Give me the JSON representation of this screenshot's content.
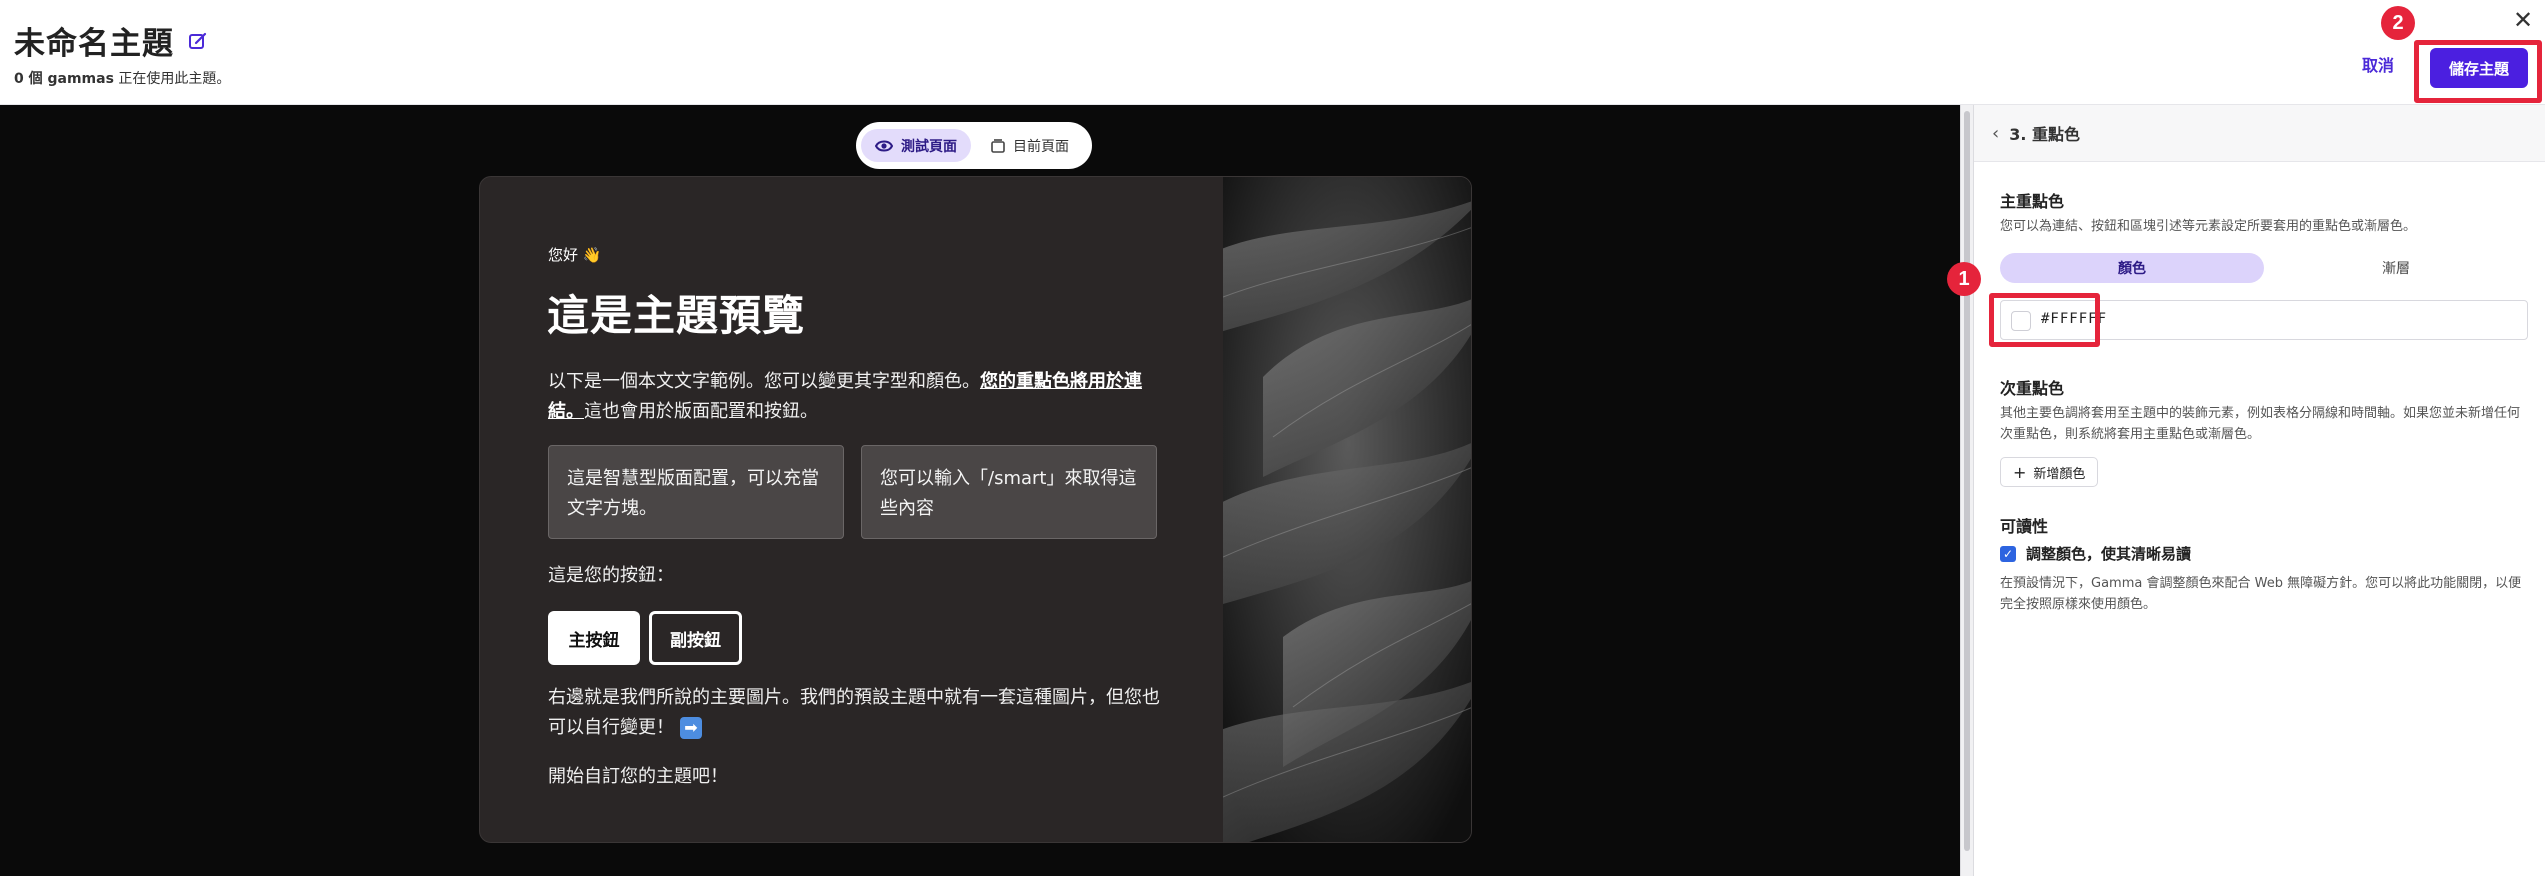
{
  "header": {
    "title": "未命名主題",
    "subtitle_count": "0 個 gammas",
    "subtitle_rest": " 正在使用此主題。",
    "cancel_label": "取消",
    "save_label": "儲存主題",
    "close_glyph": "✕",
    "badge_2": "2"
  },
  "preview": {
    "toggle": {
      "test_label": "測試頁面",
      "current_label": "目前頁面"
    },
    "hello": "您好 👋",
    "title": "這是主題預覽",
    "body_plain": "以下是一個本文文字範例。您可以變更其字型和顏色。",
    "body_link": "您的重點色將用於連結。",
    "body_tail": "這也會用於版面配置和按鈕。",
    "smart_box_1": "這是智慧型版面配置，可以充當文字方塊。",
    "smart_box_2": "您可以輸入「/smart」來取得這些內容",
    "buttons_label": "這是您的按鈕：",
    "primary_button": "主按鈕",
    "secondary_button": "副按鈕",
    "image_text": "右邊就是我們所說的主要圖片。我們的預設主題中就有一套這種圖片，但您也可以自行變更！",
    "arrow_emoji": "➡",
    "start_text": "開始自訂您的主題吧！"
  },
  "panel": {
    "step_title": "3. 重點色",
    "primary": {
      "title": "主重點色",
      "desc": "您可以為連結、按鈕和區塊引述等元素設定所要套用的重點色或漸層色。",
      "tab_color": "顏色",
      "tab_gradient": "漸層",
      "hex_value": "#FFFFFF",
      "badge_1": "1"
    },
    "secondary": {
      "title": "次重點色",
      "desc": "其他主要色調將套用至主題中的裝飾元素，例如表格分隔線和時間軸。如果您並未新增任何次重點色，則系統將套用主重點色或漸層色。",
      "add_label": "新增顏色"
    },
    "readability": {
      "title": "可讀性",
      "checkbox_label": "調整顏色，使其清晰易讀",
      "desc": "在預設情況下，Gamma 會調整顏色來配合 Web 無障礙方針。您可以將此功能關閉，以便完全按照原樣來使用顏色。"
    }
  },
  "colors": {
    "accent": "#4b1fe0",
    "highlight": "#e5243b",
    "preview_bg": "#0a0a0a",
    "card_bg": "#2a2626"
  },
  "icons": [
    "edit-icon",
    "close-icon",
    "eye-icon",
    "page-icon",
    "chevron-left-icon",
    "plus-icon",
    "check-icon"
  ]
}
